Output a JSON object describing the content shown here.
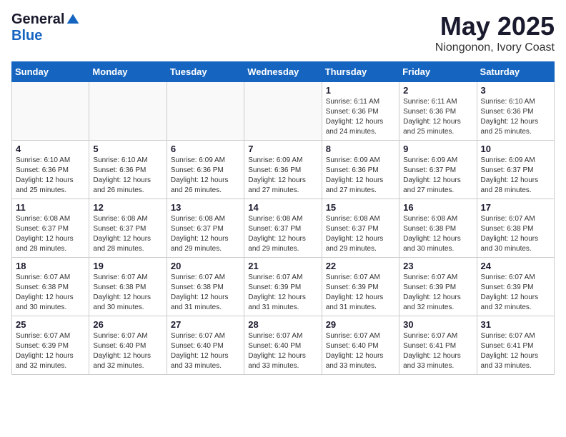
{
  "logo": {
    "general": "General",
    "blue": "Blue"
  },
  "title": "May 2025",
  "subtitle": "Niongonon, Ivory Coast",
  "headers": [
    "Sunday",
    "Monday",
    "Tuesday",
    "Wednesday",
    "Thursday",
    "Friday",
    "Saturday"
  ],
  "weeks": [
    [
      {
        "day": "",
        "detail": ""
      },
      {
        "day": "",
        "detail": ""
      },
      {
        "day": "",
        "detail": ""
      },
      {
        "day": "",
        "detail": ""
      },
      {
        "day": "1",
        "detail": "Sunrise: 6:11 AM\nSunset: 6:36 PM\nDaylight: 12 hours and 24 minutes."
      },
      {
        "day": "2",
        "detail": "Sunrise: 6:11 AM\nSunset: 6:36 PM\nDaylight: 12 hours and 25 minutes."
      },
      {
        "day": "3",
        "detail": "Sunrise: 6:10 AM\nSunset: 6:36 PM\nDaylight: 12 hours and 25 minutes."
      }
    ],
    [
      {
        "day": "4",
        "detail": "Sunrise: 6:10 AM\nSunset: 6:36 PM\nDaylight: 12 hours and 25 minutes."
      },
      {
        "day": "5",
        "detail": "Sunrise: 6:10 AM\nSunset: 6:36 PM\nDaylight: 12 hours and 26 minutes."
      },
      {
        "day": "6",
        "detail": "Sunrise: 6:09 AM\nSunset: 6:36 PM\nDaylight: 12 hours and 26 minutes."
      },
      {
        "day": "7",
        "detail": "Sunrise: 6:09 AM\nSunset: 6:36 PM\nDaylight: 12 hours and 27 minutes."
      },
      {
        "day": "8",
        "detail": "Sunrise: 6:09 AM\nSunset: 6:36 PM\nDaylight: 12 hours and 27 minutes."
      },
      {
        "day": "9",
        "detail": "Sunrise: 6:09 AM\nSunset: 6:37 PM\nDaylight: 12 hours and 27 minutes."
      },
      {
        "day": "10",
        "detail": "Sunrise: 6:09 AM\nSunset: 6:37 PM\nDaylight: 12 hours and 28 minutes."
      }
    ],
    [
      {
        "day": "11",
        "detail": "Sunrise: 6:08 AM\nSunset: 6:37 PM\nDaylight: 12 hours and 28 minutes."
      },
      {
        "day": "12",
        "detail": "Sunrise: 6:08 AM\nSunset: 6:37 PM\nDaylight: 12 hours and 28 minutes."
      },
      {
        "day": "13",
        "detail": "Sunrise: 6:08 AM\nSunset: 6:37 PM\nDaylight: 12 hours and 29 minutes."
      },
      {
        "day": "14",
        "detail": "Sunrise: 6:08 AM\nSunset: 6:37 PM\nDaylight: 12 hours and 29 minutes."
      },
      {
        "day": "15",
        "detail": "Sunrise: 6:08 AM\nSunset: 6:37 PM\nDaylight: 12 hours and 29 minutes."
      },
      {
        "day": "16",
        "detail": "Sunrise: 6:08 AM\nSunset: 6:38 PM\nDaylight: 12 hours and 30 minutes."
      },
      {
        "day": "17",
        "detail": "Sunrise: 6:07 AM\nSunset: 6:38 PM\nDaylight: 12 hours and 30 minutes."
      }
    ],
    [
      {
        "day": "18",
        "detail": "Sunrise: 6:07 AM\nSunset: 6:38 PM\nDaylight: 12 hours and 30 minutes."
      },
      {
        "day": "19",
        "detail": "Sunrise: 6:07 AM\nSunset: 6:38 PM\nDaylight: 12 hours and 30 minutes."
      },
      {
        "day": "20",
        "detail": "Sunrise: 6:07 AM\nSunset: 6:38 PM\nDaylight: 12 hours and 31 minutes."
      },
      {
        "day": "21",
        "detail": "Sunrise: 6:07 AM\nSunset: 6:39 PM\nDaylight: 12 hours and 31 minutes."
      },
      {
        "day": "22",
        "detail": "Sunrise: 6:07 AM\nSunset: 6:39 PM\nDaylight: 12 hours and 31 minutes."
      },
      {
        "day": "23",
        "detail": "Sunrise: 6:07 AM\nSunset: 6:39 PM\nDaylight: 12 hours and 32 minutes."
      },
      {
        "day": "24",
        "detail": "Sunrise: 6:07 AM\nSunset: 6:39 PM\nDaylight: 12 hours and 32 minutes."
      }
    ],
    [
      {
        "day": "25",
        "detail": "Sunrise: 6:07 AM\nSunset: 6:39 PM\nDaylight: 12 hours and 32 minutes."
      },
      {
        "day": "26",
        "detail": "Sunrise: 6:07 AM\nSunset: 6:40 PM\nDaylight: 12 hours and 32 minutes."
      },
      {
        "day": "27",
        "detail": "Sunrise: 6:07 AM\nSunset: 6:40 PM\nDaylight: 12 hours and 33 minutes."
      },
      {
        "day": "28",
        "detail": "Sunrise: 6:07 AM\nSunset: 6:40 PM\nDaylight: 12 hours and 33 minutes."
      },
      {
        "day": "29",
        "detail": "Sunrise: 6:07 AM\nSunset: 6:40 PM\nDaylight: 12 hours and 33 minutes."
      },
      {
        "day": "30",
        "detail": "Sunrise: 6:07 AM\nSunset: 6:41 PM\nDaylight: 12 hours and 33 minutes."
      },
      {
        "day": "31",
        "detail": "Sunrise: 6:07 AM\nSunset: 6:41 PM\nDaylight: 12 hours and 33 minutes."
      }
    ]
  ]
}
